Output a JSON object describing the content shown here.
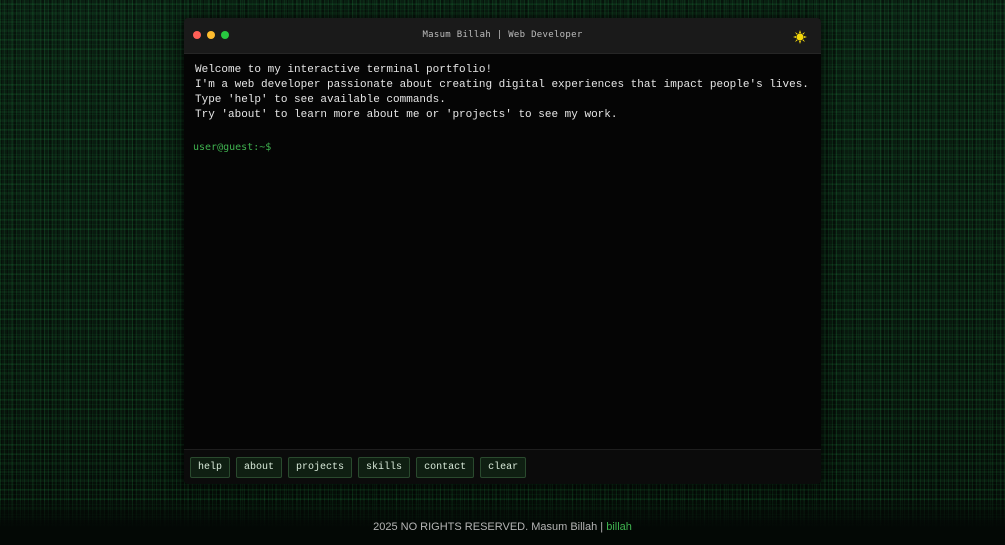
{
  "window": {
    "title": "Masum Billah | Web Developer",
    "theme_icon": "sun-icon",
    "theme_color": "#f5d90a"
  },
  "output": {
    "lines": [
      "Welcome to my interactive terminal portfolio!",
      "I'm a web developer passionate about creating digital experiences that impact people's lives.",
      "Type 'help' to see available commands.",
      "Try 'about' to learn more about me or 'projects' to see my work."
    ]
  },
  "prompt": {
    "text": "user@guest:~$",
    "value": ""
  },
  "commands": [
    "help",
    "about",
    "projects",
    "skills",
    "contact",
    "clear"
  ],
  "footer": {
    "text": "2025 NO RIGHTS RESERVED. Masum Billah | ",
    "link": "billah"
  },
  "colors": {
    "prompt_green": "#3fb24f",
    "background": "#07150c",
    "terminal_bg": "#050505"
  }
}
